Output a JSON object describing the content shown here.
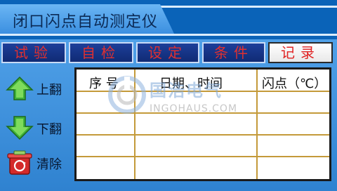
{
  "title": "闭口闪点自动测定仪",
  "menu": [
    {
      "label": "试验",
      "active": false
    },
    {
      "label": "自检",
      "active": false
    },
    {
      "label": "设定",
      "active": false
    },
    {
      "label": "条件",
      "active": false
    },
    {
      "label": "记录",
      "active": true
    }
  ],
  "side_actions": {
    "up": "上翻",
    "down": "下翻",
    "clear": "清除"
  },
  "table": {
    "columns": [
      "序 号",
      "日期、时间",
      "闪点（℃）"
    ],
    "rows": [
      [
        "",
        "",
        ""
      ],
      [
        "",
        "",
        ""
      ],
      [
        "",
        "",
        ""
      ],
      [
        "",
        "",
        ""
      ]
    ]
  },
  "watermark": {
    "brand": "国浩电气",
    "url": "INGOHAUS.COM"
  },
  "colors": {
    "accent_red": "#e03030",
    "menu_bg": "#1d3f9a",
    "table_border": "#c49a3a"
  }
}
